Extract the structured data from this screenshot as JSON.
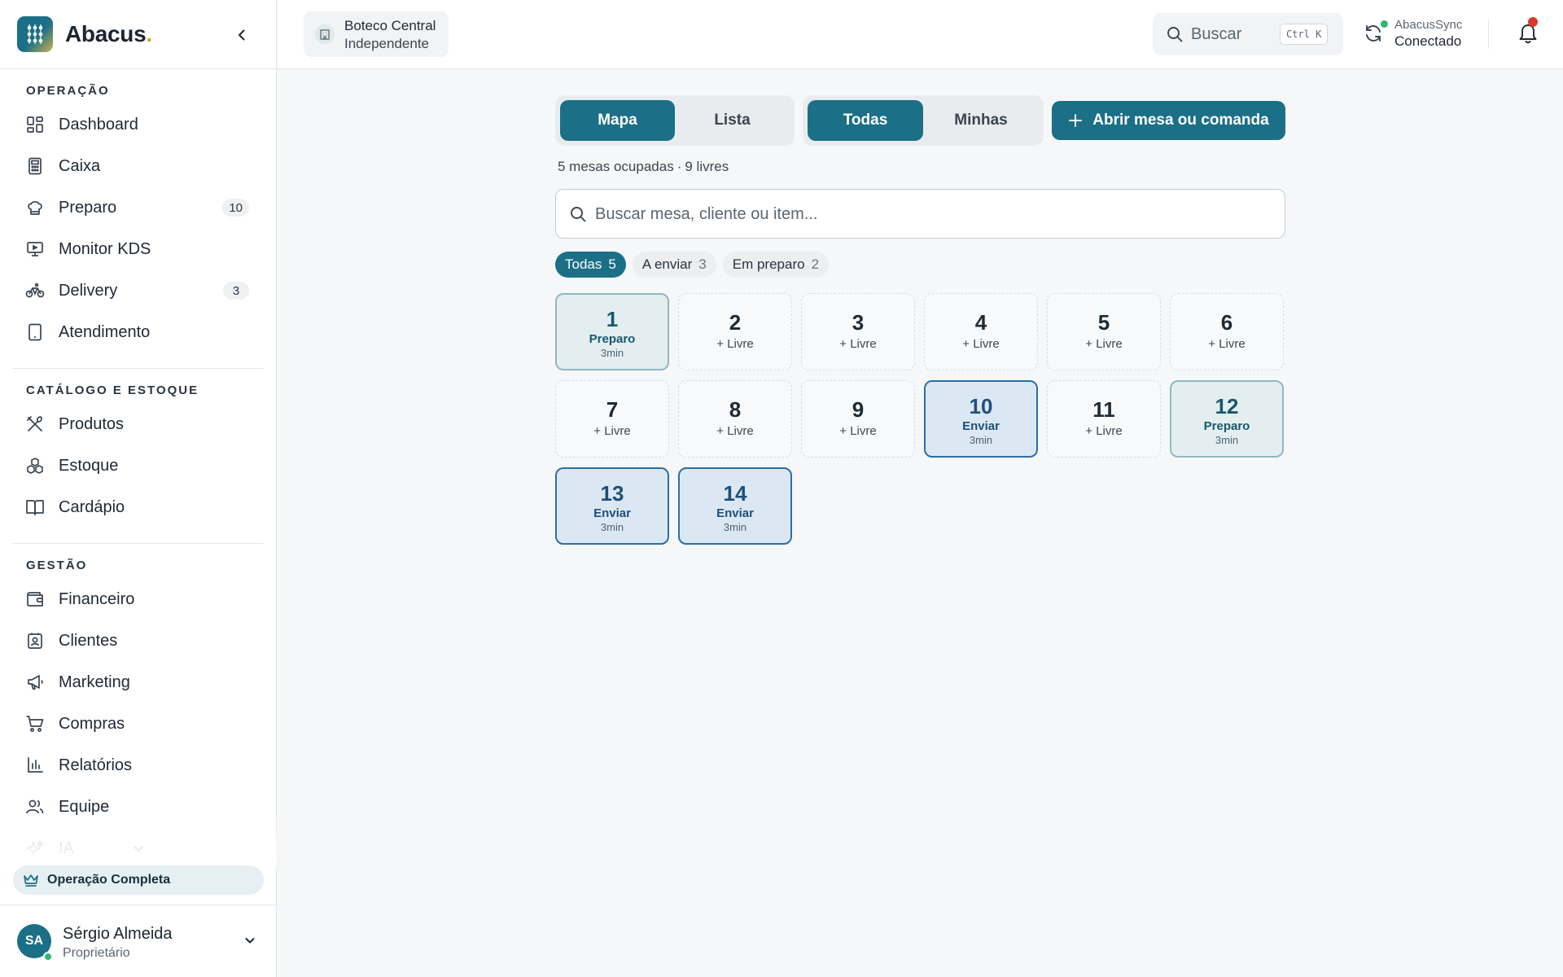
{
  "brand": {
    "name": "Abacus",
    "dot": "."
  },
  "sidebar": {
    "sections": [
      {
        "title": "OPERAÇÃO"
      },
      {
        "title": "CATÁLOGO E ESTOQUE"
      },
      {
        "title": "GESTÃO"
      }
    ],
    "items": [
      {
        "label": "Dashboard",
        "icon": "dashboard-icon"
      },
      {
        "label": "Caixa",
        "icon": "calculator-icon"
      },
      {
        "label": "Preparo",
        "icon": "chef-hat-icon",
        "badge": "10"
      },
      {
        "label": "Monitor KDS",
        "icon": "monitor-icon"
      },
      {
        "label": "Delivery",
        "icon": "bike-icon",
        "badge": "3"
      },
      {
        "label": "Atendimento",
        "icon": "tablet-icon"
      },
      {
        "label": "Produtos",
        "icon": "utensils-icon"
      },
      {
        "label": "Estoque",
        "icon": "boxes-icon"
      },
      {
        "label": "Cardápio",
        "icon": "book-icon"
      },
      {
        "label": "Financeiro",
        "icon": "wallet-icon"
      },
      {
        "label": "Clientes",
        "icon": "contact-icon"
      },
      {
        "label": "Marketing",
        "icon": "megaphone-icon"
      },
      {
        "label": "Compras",
        "icon": "cart-icon"
      },
      {
        "label": "Relatórios",
        "icon": "bar-chart-icon"
      },
      {
        "label": "Equipe",
        "icon": "users-icon"
      },
      {
        "label": "IA",
        "icon": "sparkles-icon"
      }
    ],
    "plan": "Operação Completa",
    "user": {
      "initials": "SA",
      "name": "Sérgio Almeida",
      "role": "Proprietário"
    }
  },
  "topbar": {
    "store_name": "Boteco Central",
    "store_type": "Independente",
    "search_label": "Buscar",
    "search_shortcut": "Ctrl K",
    "sync_name": "AbacusSync",
    "sync_status": "Conectado"
  },
  "main": {
    "view_tabs": [
      "Mapa",
      "Lista"
    ],
    "scope_tabs": [
      "Todas",
      "Minhas"
    ],
    "open_button": "Abrir mesa ou comanda",
    "summary_occupied": "5 mesas ocupadas",
    "summary_sep": "·",
    "summary_free": "9 livres",
    "search_placeholder": "Buscar mesa, cliente ou item...",
    "filters": [
      {
        "label": "Todas",
        "count": "5"
      },
      {
        "label": "A enviar",
        "count": "3"
      },
      {
        "label": "Em preparo",
        "count": "2"
      }
    ],
    "tables": [
      {
        "number": "1",
        "status": "Preparo",
        "time": "3min"
      },
      {
        "number": "2",
        "status": "+ Livre"
      },
      {
        "number": "3",
        "status": "+ Livre"
      },
      {
        "number": "4",
        "status": "+ Livre"
      },
      {
        "number": "5",
        "status": "+ Livre"
      },
      {
        "number": "6",
        "status": "+ Livre"
      },
      {
        "number": "7",
        "status": "+ Livre"
      },
      {
        "number": "8",
        "status": "+ Livre"
      },
      {
        "number": "9",
        "status": "+ Livre"
      },
      {
        "number": "10",
        "status": "Enviar",
        "time": "3min"
      },
      {
        "number": "11",
        "status": "+ Livre"
      },
      {
        "number": "12",
        "status": "Preparo",
        "time": "3min"
      },
      {
        "number": "13",
        "status": "Enviar",
        "time": "3min"
      },
      {
        "number": "14",
        "status": "Enviar",
        "time": "3min"
      }
    ]
  },
  "colors": {
    "accent": "#1b6f86",
    "preparo": "#8fb8c4",
    "enviar": "#2b6ea6",
    "online": "#2eb872",
    "notification": "#d93a2f"
  }
}
